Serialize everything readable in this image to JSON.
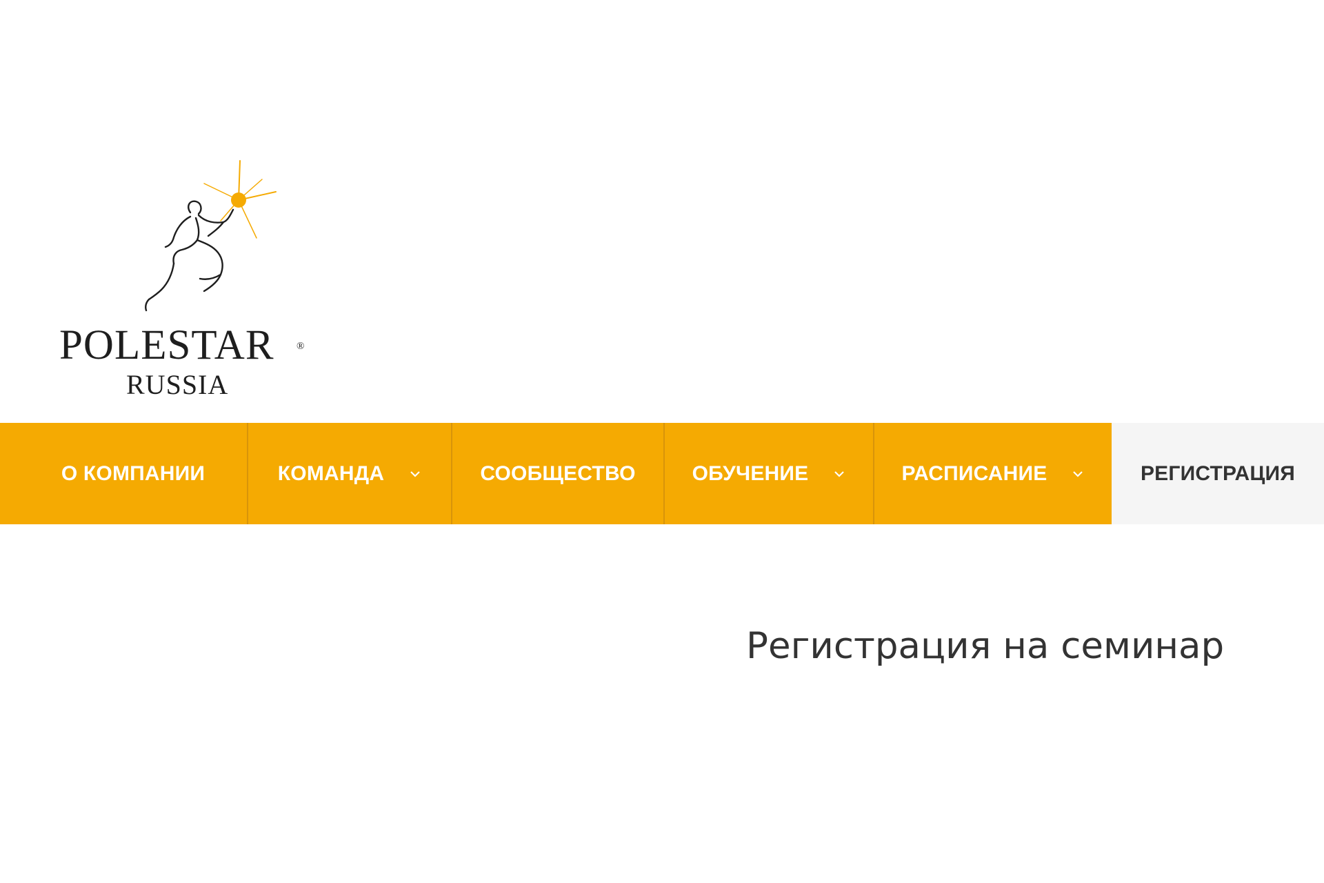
{
  "logo": {
    "brand": "POLESTAR",
    "registered": "®",
    "subtitle": "RUSSIA",
    "star_color": "#f5aa02"
  },
  "nav": {
    "items": [
      {
        "label": "О КОМПАНИИ",
        "has_dropdown": false,
        "active": false
      },
      {
        "label": "КОМАНДА",
        "has_dropdown": true,
        "active": false
      },
      {
        "label": "СООБЩЕСТВО",
        "has_dropdown": false,
        "active": false
      },
      {
        "label": "ОБУЧЕНИЕ",
        "has_dropdown": true,
        "active": false
      },
      {
        "label": "РАСПИСАНИЕ",
        "has_dropdown": true,
        "active": false
      },
      {
        "label": "РЕГИСТРАЦИЯ",
        "has_dropdown": false,
        "active": true
      }
    ],
    "background": "#f5aa02",
    "active_background": "#f5f5f5"
  },
  "main": {
    "title": "Регистрация на семинар"
  }
}
